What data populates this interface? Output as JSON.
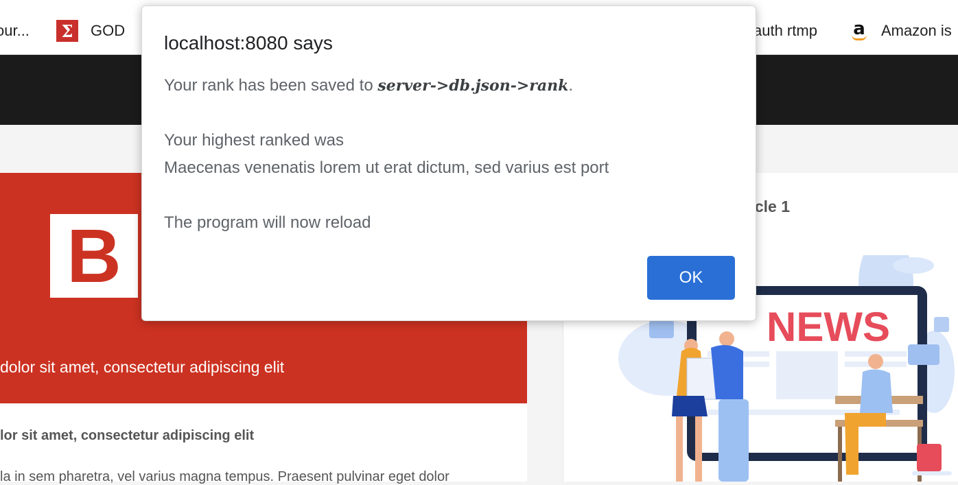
{
  "bookmarks": {
    "items": [
      {
        "label": "our..."
      },
      {
        "label": "GOD",
        "icon": "sigma-icon"
      },
      {
        "label": "auth rtmp"
      },
      {
        "label": "Amazon is",
        "icon": "amazon-icon"
      }
    ]
  },
  "page": {
    "red_card": {
      "logo_letter": "B",
      "title": "dolor sit amet, consectetur adipiscing elit"
    },
    "white_card": {
      "title": "lor sit amet, consectetur adipiscing elit",
      "body": "la in sem pharetra, vel varius magna tempus. Praesent pulvinar eget dolor"
    },
    "right_card": {
      "title": "cle 1",
      "illustration_text": "NEWS"
    }
  },
  "dialog": {
    "title": "localhost:8080 says",
    "line1_prefix": "Your rank has been saved to ",
    "line1_path": "server->db.json->rank",
    "line1_suffix": ".",
    "line2": "Your highest ranked was",
    "line3": "Maecenas venenatis lorem ut erat dictum, sed varius est port",
    "line4": "The program will now reload",
    "ok_label": "OK"
  },
  "colors": {
    "accent_red": "#cc3222",
    "ok_blue": "#2a6fd6",
    "header_dark": "#1b1b1b"
  }
}
